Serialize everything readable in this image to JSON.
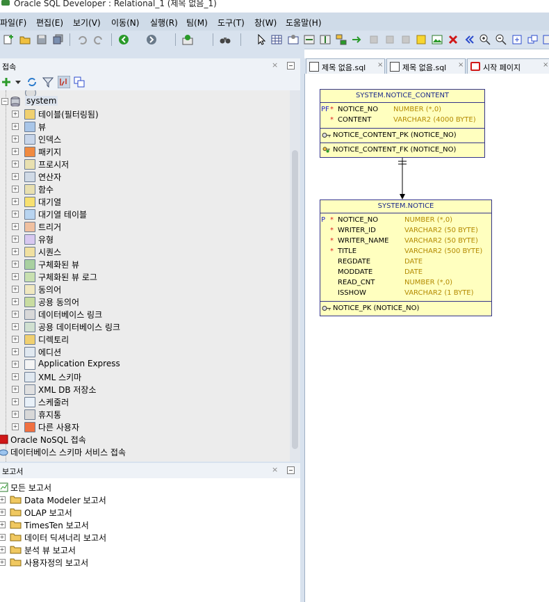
{
  "window": {
    "title": "Oracle SQL Developer : Relational_1 (제목 없음_1)"
  },
  "menu": [
    "파일(F)",
    "편집(E)",
    "보기(V)",
    "이동(N)",
    "실행(R)",
    "팀(M)",
    "도구(T)",
    "창(W)",
    "도움말(H)"
  ],
  "connections_panel": {
    "title": "접속",
    "tree": {
      "root": "system",
      "children": [
        "테이블(필터링됨)",
        "뷰",
        "인덱스",
        "패키지",
        "프로시저",
        "연산자",
        "함수",
        "대기열",
        "대기열 테이블",
        "트리거",
        "유형",
        "시퀀스",
        "구체화된 뷰",
        "구체화된 뷰 로그",
        "동의어",
        "공용 동의어",
        "데이터베이스 링크",
        "공용 데이터베이스 링크",
        "디렉토리",
        "에디션",
        "Application Express",
        "XML 스키마",
        "XML DB 저장소",
        "스케줄러",
        "휴지통",
        "다른 사용자"
      ],
      "top_level": [
        "Oracle NoSQL 접속",
        "데이터베이스 스키마 서비스 접속"
      ]
    }
  },
  "reports_panel": {
    "title": "보고서",
    "root": "모든 보고서",
    "items": [
      "Data Modeler 보고서",
      "OLAP 보고서",
      "TimesTen 보고서",
      "데이터 딕셔너리 보고서",
      "분석 뷰 보고서",
      "사용자정의 보고서"
    ]
  },
  "editor_tabs": [
    "제목 없음.sql",
    "제목 없음.sql",
    "시작 페이지"
  ],
  "diagram": {
    "notice_content": {
      "name": "SYSTEM.NOTICE_CONTENT",
      "columns": [
        {
          "flag": "PF",
          "req": "*",
          "name": "NOTICE_NO",
          "type": "NUMBER (*,0)"
        },
        {
          "flag": "",
          "req": "*",
          "name": "CONTENT",
          "type": "VARCHAR2 (4000 BYTE)"
        }
      ],
      "pk": "NOTICE_CONTENT_PK (NOTICE_NO)",
      "fk": "NOTICE_CONTENT_FK (NOTICE_NO)"
    },
    "notice": {
      "name": "SYSTEM.NOTICE",
      "columns": [
        {
          "flag": "P",
          "req": "*",
          "name": "NOTICE_NO",
          "type": "NUMBER (*,0)"
        },
        {
          "flag": "",
          "req": "*",
          "name": "WRITER_ID",
          "type": "VARCHAR2 (50 BYTE)"
        },
        {
          "flag": "",
          "req": "*",
          "name": "WRITER_NAME",
          "type": "VARCHAR2 (50 BYTE)"
        },
        {
          "flag": "",
          "req": "*",
          "name": "TITLE",
          "type": "VARCHAR2 (500 BYTE)"
        },
        {
          "flag": "",
          "req": "",
          "name": "REGDATE",
          "type": "DATE"
        },
        {
          "flag": "",
          "req": "",
          "name": "MODDATE",
          "type": "DATE"
        },
        {
          "flag": "",
          "req": "",
          "name": "READ_CNT",
          "type": "NUMBER (*,0)"
        },
        {
          "flag": "",
          "req": "",
          "name": "ISSHOW",
          "type": "VARCHAR2 (1 BYTE)"
        }
      ],
      "pk": "NOTICE_PK (NOTICE_NO)"
    }
  }
}
